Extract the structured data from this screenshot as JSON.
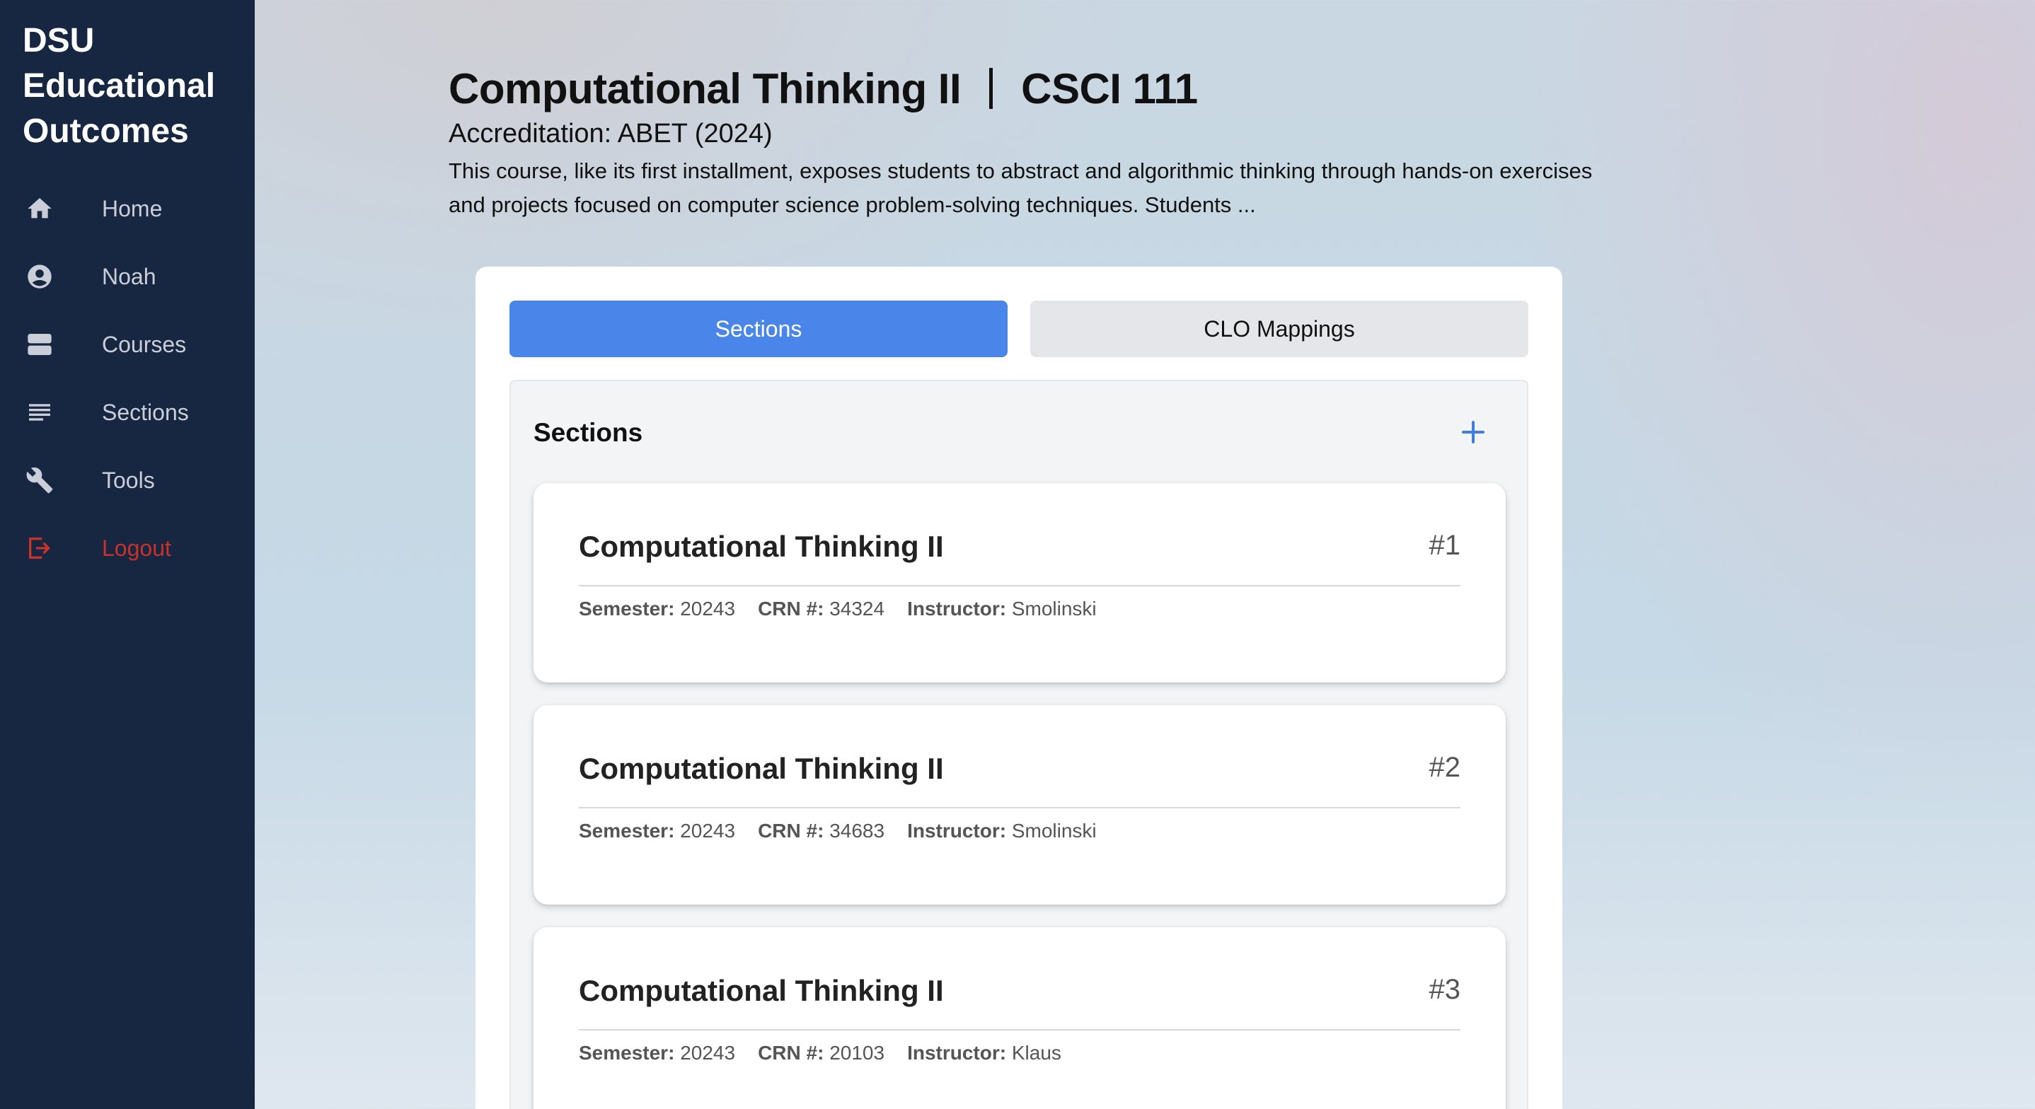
{
  "sidebar": {
    "brand": [
      "DSU",
      "Educational",
      "Outcomes"
    ],
    "items": [
      {
        "label": "Home",
        "icon": "home-icon"
      },
      {
        "label": "Noah",
        "icon": "user-circle-icon"
      },
      {
        "label": "Courses",
        "icon": "courses-icon"
      },
      {
        "label": "Sections",
        "icon": "list-icon"
      },
      {
        "label": "Tools",
        "icon": "wrench-icon"
      },
      {
        "label": "Logout",
        "icon": "logout-icon"
      }
    ]
  },
  "header": {
    "course_name": "Computational Thinking II",
    "course_code": "CSCI 111",
    "accreditation": "Accreditation: ABET (2024)",
    "description": "This course, like its first installment, exposes students to abstract and algorithmic thinking through hands-on exercises and projects focused on computer science problem-solving techniques. Students ..."
  },
  "tabs": {
    "sections": "Sections",
    "clo": "CLO Mappings"
  },
  "sections": {
    "heading": "Sections",
    "add_icon": "plus-icon",
    "labels": {
      "semester": "Semester:",
      "crn": "CRN #:",
      "instructor": "Instructor:"
    },
    "cards": [
      {
        "title": "Computational Thinking II",
        "number": "#1",
        "semester": "20243",
        "crn": "34324",
        "instructor": "Smolinski"
      },
      {
        "title": "Computational Thinking II",
        "number": "#2",
        "semester": "20243",
        "crn": "34683",
        "instructor": "Smolinski"
      },
      {
        "title": "Computational Thinking II",
        "number": "#3",
        "semester": "20243",
        "crn": "20103",
        "instructor": "Klaus"
      }
    ]
  },
  "colors": {
    "sidebar": "#172641",
    "accent": "#4a86ea",
    "logout": "#c8322a"
  }
}
